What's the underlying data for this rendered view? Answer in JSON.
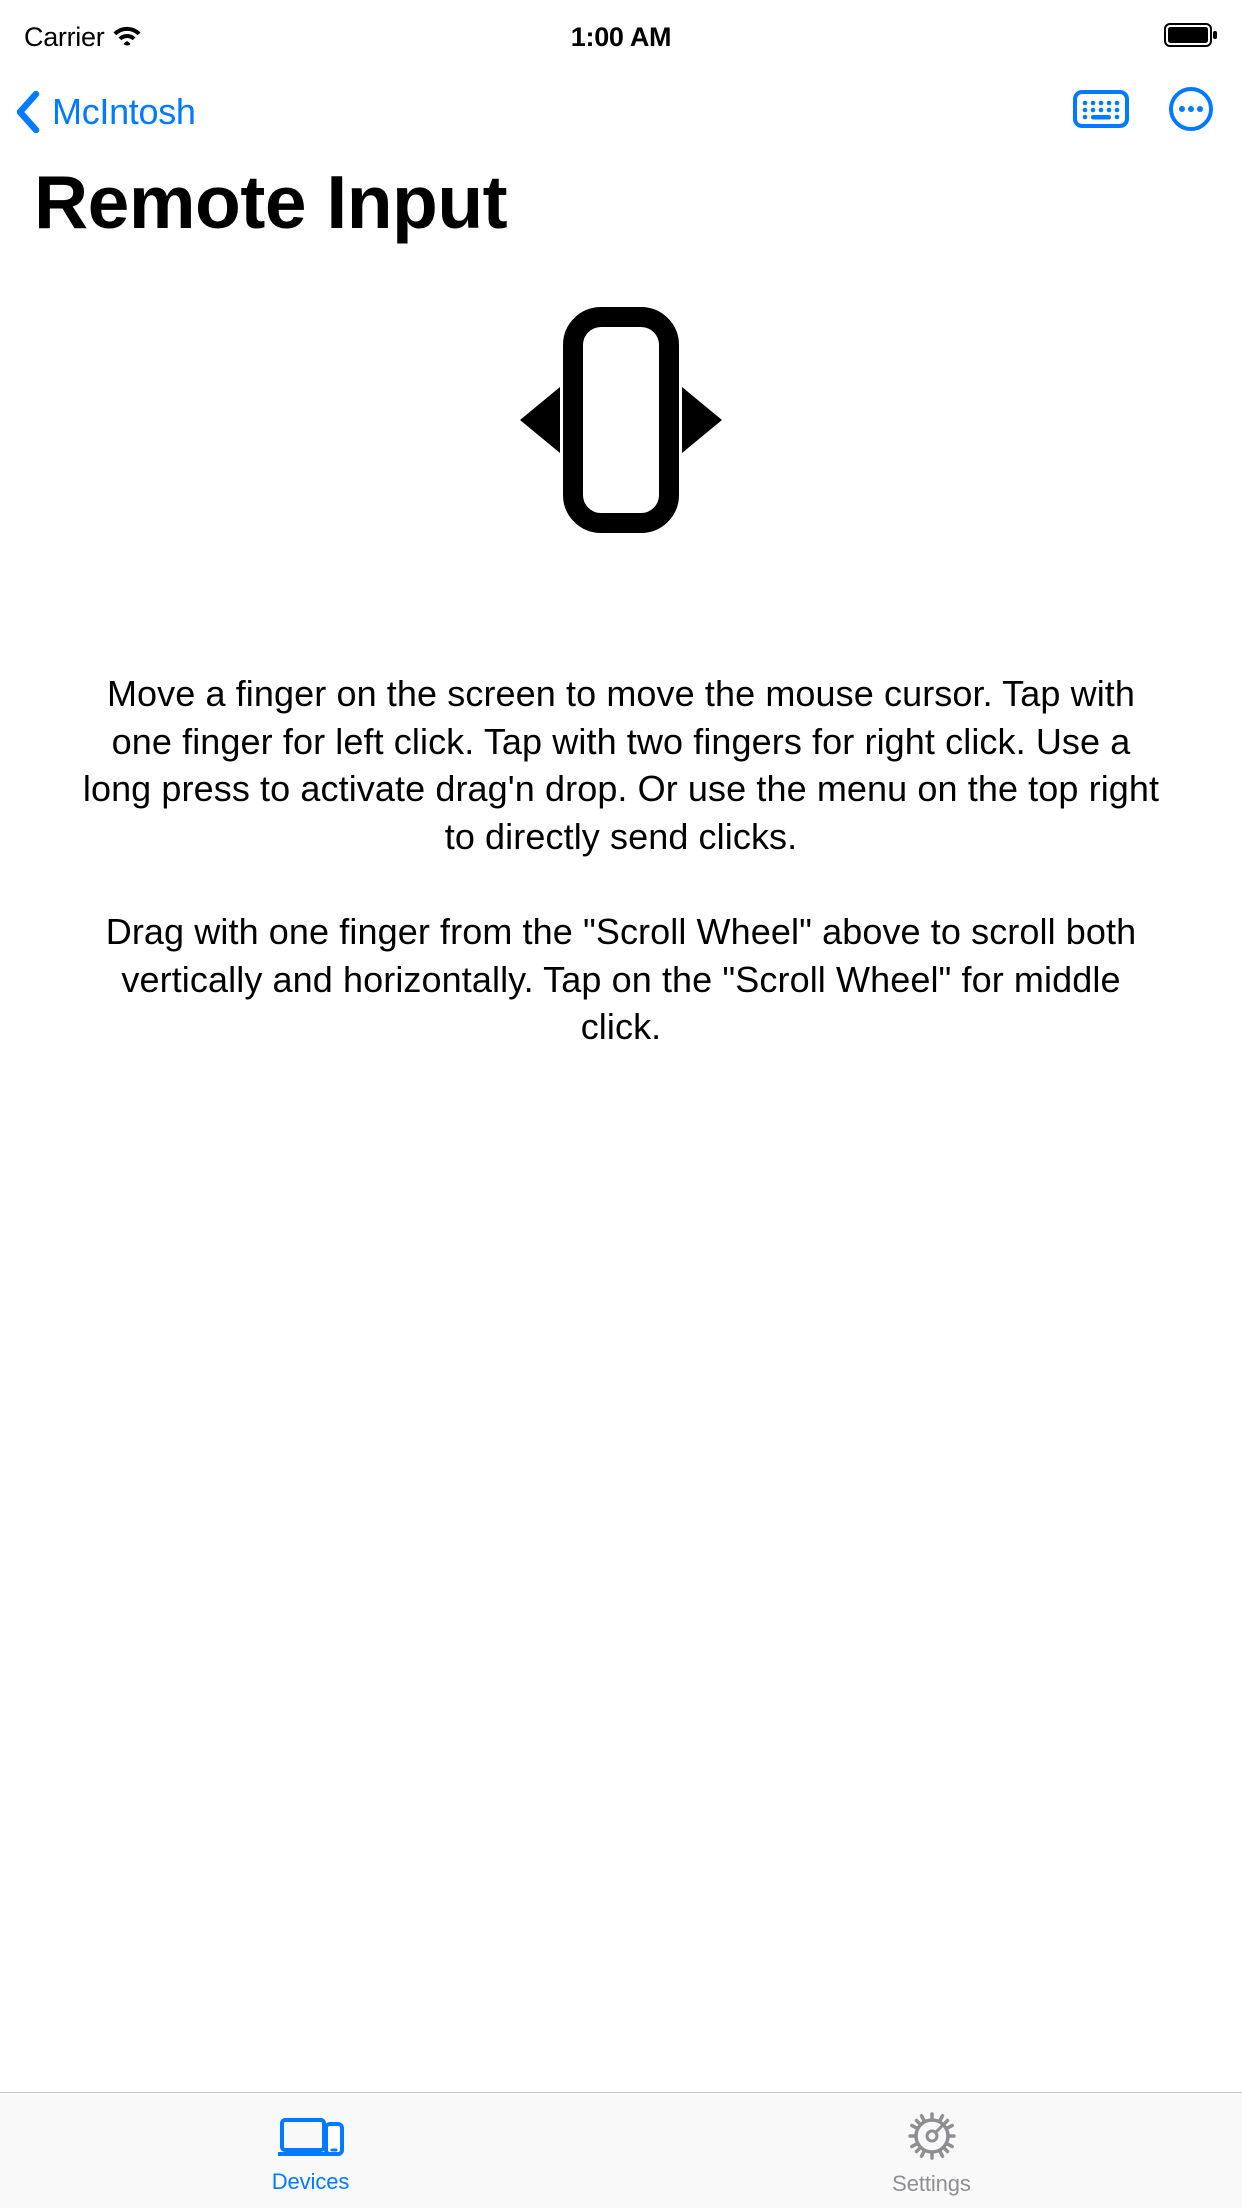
{
  "status": {
    "carrier": "Carrier",
    "time": "1:00 AM"
  },
  "nav": {
    "back_label": "McIntosh"
  },
  "page": {
    "title": "Remote Input"
  },
  "instructions": {
    "p1": "Move a finger on the screen to move the mouse cursor. Tap with one finger for left click. Tap with two fingers for right click. Use a long press to activate drag'n drop. Or use the menu on the top right to directly send clicks.",
    "p2": "Drag with one finger from the \"Scroll Wheel\" above to scroll both vertically and horizontally. Tap on the \"Scroll Wheel\" for middle click."
  },
  "tabs": {
    "devices": "Devices",
    "settings": "Settings"
  },
  "colors": {
    "accent": "#007aff",
    "inactive": "#8e8e93"
  }
}
